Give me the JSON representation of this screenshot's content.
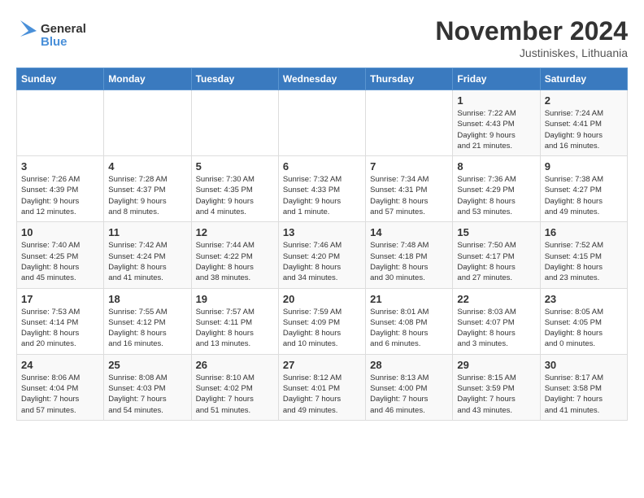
{
  "logo": {
    "line1": "General",
    "line2": "Blue"
  },
  "title": "November 2024",
  "subtitle": "Justiniskes, Lithuania",
  "days_header": [
    "Sunday",
    "Monday",
    "Tuesday",
    "Wednesday",
    "Thursday",
    "Friday",
    "Saturday"
  ],
  "weeks": [
    [
      {
        "day": "",
        "info": ""
      },
      {
        "day": "",
        "info": ""
      },
      {
        "day": "",
        "info": ""
      },
      {
        "day": "",
        "info": ""
      },
      {
        "day": "",
        "info": ""
      },
      {
        "day": "1",
        "info": "Sunrise: 7:22 AM\nSunset: 4:43 PM\nDaylight: 9 hours\nand 21 minutes."
      },
      {
        "day": "2",
        "info": "Sunrise: 7:24 AM\nSunset: 4:41 PM\nDaylight: 9 hours\nand 16 minutes."
      }
    ],
    [
      {
        "day": "3",
        "info": "Sunrise: 7:26 AM\nSunset: 4:39 PM\nDaylight: 9 hours\nand 12 minutes."
      },
      {
        "day": "4",
        "info": "Sunrise: 7:28 AM\nSunset: 4:37 PM\nDaylight: 9 hours\nand 8 minutes."
      },
      {
        "day": "5",
        "info": "Sunrise: 7:30 AM\nSunset: 4:35 PM\nDaylight: 9 hours\nand 4 minutes."
      },
      {
        "day": "6",
        "info": "Sunrise: 7:32 AM\nSunset: 4:33 PM\nDaylight: 9 hours\nand 1 minute."
      },
      {
        "day": "7",
        "info": "Sunrise: 7:34 AM\nSunset: 4:31 PM\nDaylight: 8 hours\nand 57 minutes."
      },
      {
        "day": "8",
        "info": "Sunrise: 7:36 AM\nSunset: 4:29 PM\nDaylight: 8 hours\nand 53 minutes."
      },
      {
        "day": "9",
        "info": "Sunrise: 7:38 AM\nSunset: 4:27 PM\nDaylight: 8 hours\nand 49 minutes."
      }
    ],
    [
      {
        "day": "10",
        "info": "Sunrise: 7:40 AM\nSunset: 4:25 PM\nDaylight: 8 hours\nand 45 minutes."
      },
      {
        "day": "11",
        "info": "Sunrise: 7:42 AM\nSunset: 4:24 PM\nDaylight: 8 hours\nand 41 minutes."
      },
      {
        "day": "12",
        "info": "Sunrise: 7:44 AM\nSunset: 4:22 PM\nDaylight: 8 hours\nand 38 minutes."
      },
      {
        "day": "13",
        "info": "Sunrise: 7:46 AM\nSunset: 4:20 PM\nDaylight: 8 hours\nand 34 minutes."
      },
      {
        "day": "14",
        "info": "Sunrise: 7:48 AM\nSunset: 4:18 PM\nDaylight: 8 hours\nand 30 minutes."
      },
      {
        "day": "15",
        "info": "Sunrise: 7:50 AM\nSunset: 4:17 PM\nDaylight: 8 hours\nand 27 minutes."
      },
      {
        "day": "16",
        "info": "Sunrise: 7:52 AM\nSunset: 4:15 PM\nDaylight: 8 hours\nand 23 minutes."
      }
    ],
    [
      {
        "day": "17",
        "info": "Sunrise: 7:53 AM\nSunset: 4:14 PM\nDaylight: 8 hours\nand 20 minutes."
      },
      {
        "day": "18",
        "info": "Sunrise: 7:55 AM\nSunset: 4:12 PM\nDaylight: 8 hours\nand 16 minutes."
      },
      {
        "day": "19",
        "info": "Sunrise: 7:57 AM\nSunset: 4:11 PM\nDaylight: 8 hours\nand 13 minutes."
      },
      {
        "day": "20",
        "info": "Sunrise: 7:59 AM\nSunset: 4:09 PM\nDaylight: 8 hours\nand 10 minutes."
      },
      {
        "day": "21",
        "info": "Sunrise: 8:01 AM\nSunset: 4:08 PM\nDaylight: 8 hours\nand 6 minutes."
      },
      {
        "day": "22",
        "info": "Sunrise: 8:03 AM\nSunset: 4:07 PM\nDaylight: 8 hours\nand 3 minutes."
      },
      {
        "day": "23",
        "info": "Sunrise: 8:05 AM\nSunset: 4:05 PM\nDaylight: 8 hours\nand 0 minutes."
      }
    ],
    [
      {
        "day": "24",
        "info": "Sunrise: 8:06 AM\nSunset: 4:04 PM\nDaylight: 7 hours\nand 57 minutes."
      },
      {
        "day": "25",
        "info": "Sunrise: 8:08 AM\nSunset: 4:03 PM\nDaylight: 7 hours\nand 54 minutes."
      },
      {
        "day": "26",
        "info": "Sunrise: 8:10 AM\nSunset: 4:02 PM\nDaylight: 7 hours\nand 51 minutes."
      },
      {
        "day": "27",
        "info": "Sunrise: 8:12 AM\nSunset: 4:01 PM\nDaylight: 7 hours\nand 49 minutes."
      },
      {
        "day": "28",
        "info": "Sunrise: 8:13 AM\nSunset: 4:00 PM\nDaylight: 7 hours\nand 46 minutes."
      },
      {
        "day": "29",
        "info": "Sunrise: 8:15 AM\nSunset: 3:59 PM\nDaylight: 7 hours\nand 43 minutes."
      },
      {
        "day": "30",
        "info": "Sunrise: 8:17 AM\nSunset: 3:58 PM\nDaylight: 7 hours\nand 41 minutes."
      }
    ]
  ]
}
